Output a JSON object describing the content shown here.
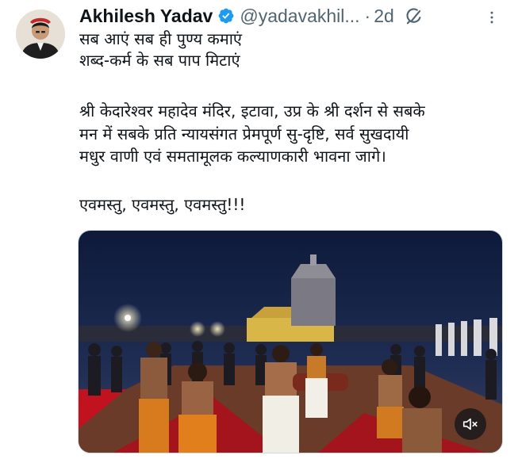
{
  "author": {
    "display_name": "Akhilesh Yadav",
    "handle": "@yadavakhil...",
    "separator": "·",
    "time_ago": "2d"
  },
  "tweet": {
    "lines": [
      "सब आएं सब ही पुण्य कमाएं",
      "शब्द-कर्म के सब पाप मिटाएं",
      "",
      "श्री केदारेश्वर महादेव मंदिर, इटावा, उप्र के  श्री दर्शन से सबके",
      "मन में सबके प्रति न्यायसंगत प्रेमपूर्ण सु-दृष्टि, सर्व सुखदायी",
      "मधुर वाणी एवं समतामूलक कल्याणकारी भावना जागे।",
      "",
      "एवमस्तु, एवमस्तु, एवमस्तु!!!"
    ]
  },
  "icons": {
    "verified": "verified-badge-icon",
    "grok": "grok-icon",
    "more": "more-options-icon",
    "mute": "muted-speaker-icon"
  },
  "colors": {
    "verified_blue": "#1d9bf0",
    "secondary_text": "#536471",
    "primary_text": "#0f1419"
  }
}
